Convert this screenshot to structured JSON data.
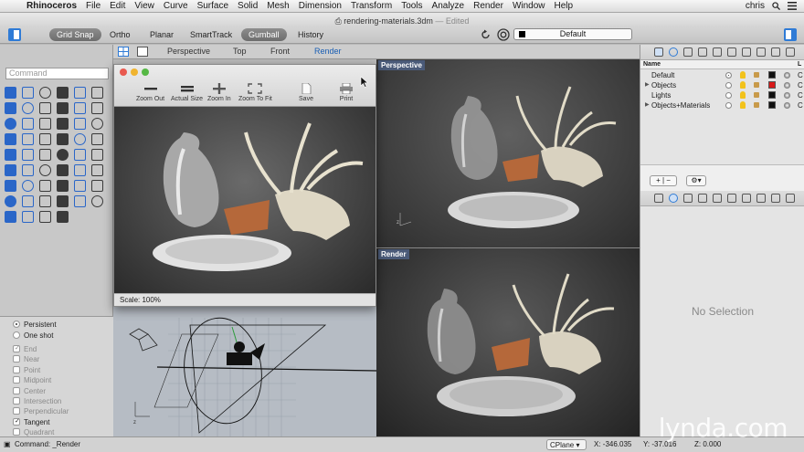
{
  "menubar": {
    "app_name": "Rhinoceros",
    "items": [
      "File",
      "Edit",
      "View",
      "Curve",
      "Surface",
      "Solid",
      "Mesh",
      "Dimension",
      "Transform",
      "Tools",
      "Analyze",
      "Render",
      "Window",
      "Help"
    ],
    "user": "chris"
  },
  "window": {
    "filename": "rendering-materials.3dm",
    "edited": "— Edited"
  },
  "toolbar": {
    "buttons": [
      "Grid Snap",
      "Ortho",
      "Planar",
      "SmartTrack",
      "Gumball",
      "History"
    ],
    "layer_current": "Default"
  },
  "viewport_tabs": [
    "Perspective",
    "Top",
    "Front",
    "Render"
  ],
  "command_placeholder": "Command",
  "render_window": {
    "buttons": [
      "Zoom Out",
      "Actual Size",
      "Zoom In",
      "Zoom To Fit",
      "Save",
      "Print"
    ],
    "scale": "Scale: 100%"
  },
  "viewports": {
    "perspective_label": "Perspective",
    "render_label": "Render"
  },
  "osnap": {
    "persistent": "Persistent",
    "one_shot": "One shot",
    "items": [
      {
        "label": "End",
        "checked": true,
        "dim": true
      },
      {
        "label": "Near",
        "checked": false,
        "dim": true
      },
      {
        "label": "Point",
        "checked": false,
        "dim": true
      },
      {
        "label": "Midpoint",
        "checked": false,
        "dim": true
      },
      {
        "label": "Center",
        "checked": false,
        "dim": true
      },
      {
        "label": "Intersection",
        "checked": false,
        "dim": true
      },
      {
        "label": "Perpendicular",
        "checked": false,
        "dim": true
      },
      {
        "label": "Tangent",
        "checked": true,
        "dim": false
      },
      {
        "label": "Quadrant",
        "checked": false,
        "dim": true
      }
    ]
  },
  "layers": {
    "header_name": "Name",
    "header_extra": "L",
    "rows": [
      {
        "name": "Default",
        "color": "#111111",
        "expand": false,
        "current": true
      },
      {
        "name": "Objects",
        "color": "#d81818",
        "expand": true,
        "current": false
      },
      {
        "name": "Lights",
        "color": "#111111",
        "expand": false,
        "current": false
      },
      {
        "name": "Objects+Materials",
        "color": "#111111",
        "expand": true,
        "current": false
      }
    ],
    "row_tail": "C",
    "add_remove": "+ | −"
  },
  "properties": {
    "empty_text": "No Selection"
  },
  "statusbar": {
    "command": "Command: _Render",
    "cplane": "CPlane",
    "x": "X: -346.035",
    "y": "Y: -37.016",
    "z": "Z: 0.000"
  },
  "watermark": "lynda.com",
  "colors": {
    "accent": "#2f7bd6",
    "viewport_label_bg": "#4a5a78"
  }
}
